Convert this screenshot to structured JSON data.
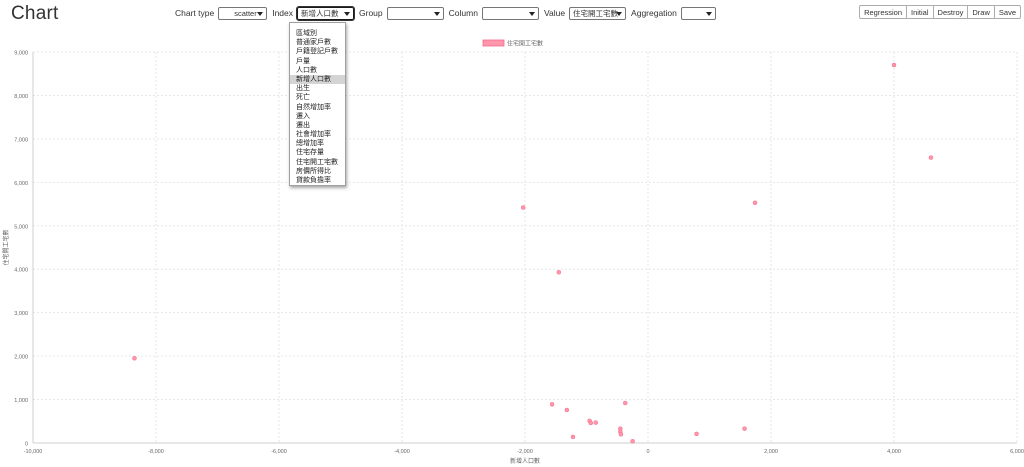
{
  "app": {
    "title": "Chart"
  },
  "toolbar": {
    "chart_type_label": "Chart type",
    "chart_type_value": "scatter",
    "index_label": "Index",
    "index_value": "新增人口數",
    "group_label": "Group",
    "group_value": "",
    "column_label": "Column",
    "column_value": "",
    "value_label": "Value",
    "value_value": "住宅開工宅數",
    "aggregation_label": "Aggregation",
    "aggregation_value": ""
  },
  "buttons": {
    "regression": "Regression",
    "initial": "Initial",
    "destroy": "Destroy",
    "draw": "Draw",
    "save": "Save"
  },
  "index_dropdown": {
    "options": [
      "區域別",
      "普通家戶數",
      "戶籍登記戶數",
      "戶量",
      "人口數",
      "新增人口數",
      "出生",
      "死亡",
      "自然增加率",
      "遷入",
      "遷出",
      "社會增加率",
      "總增加率",
      "住宅存量",
      "住宅開工宅數",
      "房價所得比",
      "貸款負擔率"
    ],
    "selected_index": 5
  },
  "colors": {
    "series_fill": "#ff96ab",
    "series_border": "#f06c8a",
    "grid": "#e6e6e6"
  },
  "chart_data": {
    "type": "scatter",
    "xlabel": "新增人口數",
    "ylabel": "住宅開工宅數",
    "xlim": [
      -10000,
      6000
    ],
    "ylim": [
      0,
      9000
    ],
    "xticks": [
      -10000,
      -8000,
      -6000,
      -4000,
      -2000,
      0,
      2000,
      4000,
      6000
    ],
    "yticks": [
      0,
      1000,
      2000,
      3000,
      4000,
      5000,
      6000,
      7000,
      8000,
      9000
    ],
    "legend": "top-center",
    "series": [
      {
        "name": "住宅開工宅數",
        "points": [
          {
            "x": -8350,
            "y": 1950
          },
          {
            "x": -2030,
            "y": 5420
          },
          {
            "x": -1450,
            "y": 3930
          },
          {
            "x": -1560,
            "y": 890
          },
          {
            "x": -1320,
            "y": 760
          },
          {
            "x": -1220,
            "y": 140
          },
          {
            "x": -950,
            "y": 510
          },
          {
            "x": -930,
            "y": 460
          },
          {
            "x": -850,
            "y": 470
          },
          {
            "x": -450,
            "y": 330
          },
          {
            "x": -450,
            "y": 260
          },
          {
            "x": -440,
            "y": 200
          },
          {
            "x": -370,
            "y": 920
          },
          {
            "x": -250,
            "y": 40
          },
          {
            "x": 790,
            "y": 210
          },
          {
            "x": 1570,
            "y": 330
          },
          {
            "x": 1740,
            "y": 5530
          },
          {
            "x": 4000,
            "y": 8700
          },
          {
            "x": 4600,
            "y": 6570
          }
        ]
      }
    ]
  }
}
